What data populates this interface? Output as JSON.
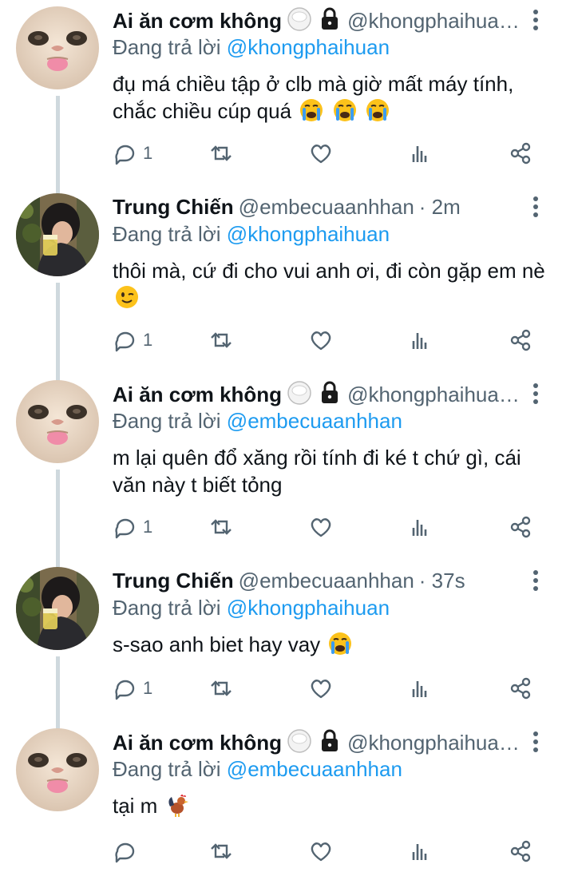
{
  "tweets": [
    {
      "display_name": "Ai ăn cơm không",
      "handle": "@khongphaihua…",
      "time": "",
      "reply_label": "Đang trả lời",
      "reply_to": "@khongphaihuan",
      "text": "đụ má chiều tập ở clb mà giờ mất máy tính, chắc chiều cúp quá",
      "emojis": [
        "loudly-crying-face",
        "loudly-crying-face",
        "loudly-crying-face"
      ],
      "reply_count": "1",
      "avatar": "cat-face",
      "badges": [
        "rice-ball",
        "lock"
      ]
    },
    {
      "display_name": "Trung Chiến",
      "handle": "@embecuaanhhan",
      "time": "· 2m",
      "reply_label": "Đang trả lời",
      "reply_to": "@khongphaihuan",
      "text": "thôi mà, cứ đi cho vui anh ơi, đi còn gặp em nè",
      "emojis": [
        "winking-face"
      ],
      "reply_count": "1",
      "avatar": "person-drinking",
      "badges": []
    },
    {
      "display_name": "Ai ăn cơm không",
      "handle": "@khongphaihua…",
      "time": "",
      "reply_label": "Đang trả lời",
      "reply_to": "@embecuaanhhan",
      "text": "m lại quên đổ xăng rồi tính đi ké t chứ gì, cái văn này t biết tỏng",
      "emojis": [],
      "reply_count": "1",
      "avatar": "cat-face",
      "badges": [
        "rice-ball",
        "lock"
      ]
    },
    {
      "display_name": "Trung Chiến",
      "handle": "@embecuaanhhan",
      "time": "· 37s",
      "reply_label": "Đang trả lời",
      "reply_to": "@khongphaihuan",
      "text": "s-sao anh biet hay vay",
      "emojis": [
        "loudly-crying-face"
      ],
      "reply_count": "1",
      "avatar": "person-drinking",
      "badges": []
    },
    {
      "display_name": "Ai ăn cơm không",
      "handle": "@khongphaihua…",
      "time": "",
      "reply_label": "Đang trả lời",
      "reply_to": "@embecuaanhhan",
      "text": "tại m",
      "emojis": [
        "rooster"
      ],
      "reply_count": "",
      "avatar": "cat-face",
      "badges": [
        "rice-ball",
        "lock"
      ]
    }
  ],
  "action_icons": [
    "reply-icon",
    "retweet-icon",
    "like-icon",
    "views-icon",
    "share-icon"
  ],
  "colors": {
    "text": "#0f1419",
    "secondary": "#536471",
    "link": "#1d9bf0",
    "thread_line": "#cfd9de"
  }
}
